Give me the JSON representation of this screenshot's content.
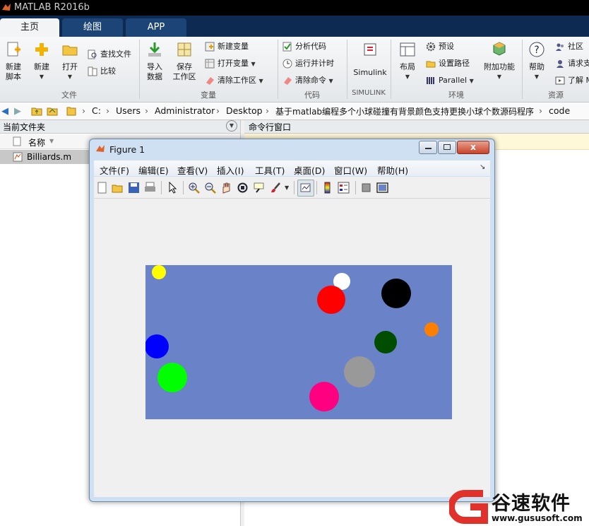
{
  "app": {
    "title": "MATLAB R2016b"
  },
  "tabs": [
    {
      "label": "主页",
      "active": true
    },
    {
      "label": "绘图",
      "active": false
    },
    {
      "label": "APP",
      "active": false
    }
  ],
  "ribbon": {
    "file": {
      "new_script": "新建\n脚本",
      "new_script_1": "新建",
      "new_script_2": "脚本",
      "new": "新建",
      "open": "打开",
      "find_files": "查找文件",
      "compare": "比较",
      "group": "文件"
    },
    "variable": {
      "import_1": "导入",
      "import_2": "数据",
      "save_1": "保存",
      "save_2": "工作区",
      "new_var": "新建变量",
      "open_var": "打开变量",
      "clear_ws": "清除工作区",
      "group": "变量"
    },
    "code": {
      "analyze": "分析代码",
      "run_time": "运行并计时",
      "clear_cmd": "清除命令",
      "group": "代码"
    },
    "simulink": {
      "label": "Simulink",
      "group": "SIMULINK"
    },
    "env": {
      "layout": "布局",
      "prefs": "预设",
      "set_path": "设置路径",
      "parallel": "Parallel",
      "addons": "附加功能",
      "group": "环境"
    },
    "resources": {
      "help": "帮助",
      "community": "社区",
      "request": "请求支",
      "learn": "了解 M",
      "group": "资源"
    }
  },
  "address": {
    "drive": "C:",
    "parts": [
      "Users",
      "Administrator",
      "Desktop",
      "基于matlab编程多个小球碰撞有背景颜色支持更换小球个数源码程序",
      "code"
    ]
  },
  "left_panel": {
    "title": "当前文件夹",
    "col_name": "名称",
    "files": [
      "Billiards.m"
    ]
  },
  "command_window": {
    "title": "命令行窗口"
  },
  "figure": {
    "title": "Figure 1",
    "menu": [
      "文件(F)",
      "编辑(E)",
      "查看(V)",
      "插入(I)",
      "工具(T)",
      "桌面(D)",
      "窗口(W)",
      "帮助(H)"
    ],
    "toolbar_icons": [
      "new-figure-icon",
      "open-file-icon",
      "save-icon",
      "print-icon",
      "pointer-icon",
      "zoom-in-icon",
      "zoom-out-icon",
      "pan-hand-icon",
      "rotate-3d-icon",
      "data-cursor-icon",
      "brush-icon",
      "link-plot-icon",
      "colorbar-icon",
      "legend-icon",
      "hide-plot-tools-icon",
      "show-plot-tools-icon"
    ],
    "plot": {
      "background": "#6a82c8",
      "balls": [
        {
          "color": "#ffff00"
        },
        {
          "color": "#ffffff"
        },
        {
          "color": "#ff0000"
        },
        {
          "color": "#000000"
        },
        {
          "color": "#ff8000"
        },
        {
          "color": "#0000ff"
        },
        {
          "color": "#004d00"
        },
        {
          "color": "#00ff00"
        },
        {
          "color": "#999999"
        },
        {
          "color": "#ff0080"
        }
      ]
    }
  },
  "watermark": {
    "brand": "谷速软件",
    "url": "www.gususoft.com"
  },
  "colors": {
    "tab_bar": "#0d2b52",
    "ribbon_bg": "#eef0f2",
    "accent": "#e0322a"
  }
}
